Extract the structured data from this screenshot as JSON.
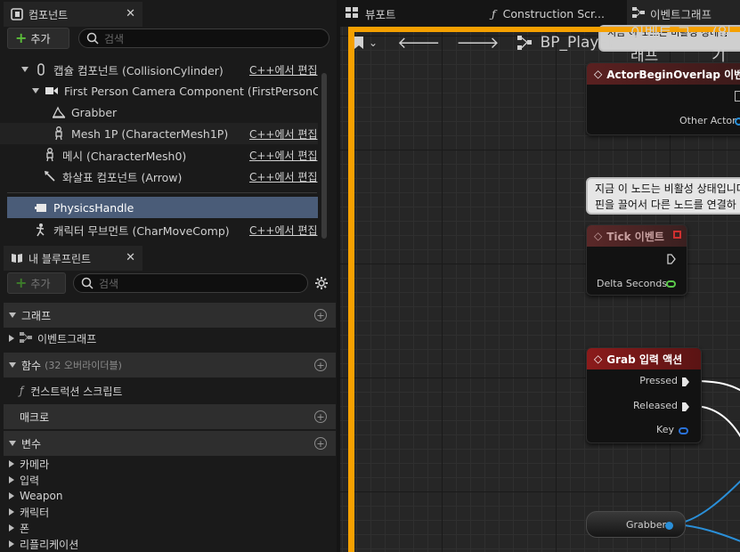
{
  "components_panel": {
    "tab_title": "컴포넌트",
    "add_label": "추가",
    "search_placeholder": "검색",
    "items": [
      {
        "label": "캡슐 컴포넌트 (CollisionCylinder)",
        "edit": "C++에서 편집"
      },
      {
        "label": "First Person Camera Component (FirstPersonCamera)",
        "edit": ""
      },
      {
        "label": "Grabber",
        "edit": ""
      },
      {
        "label": "Mesh 1P (CharacterMesh1P)",
        "edit": "C++에서 편집"
      },
      {
        "label": "메시 (CharacterMesh0)",
        "edit": "C++에서 편집"
      },
      {
        "label": "화살표 컴포넌트 (Arrow)",
        "edit": "C++에서 편집"
      },
      {
        "label": "PhysicsHandle",
        "edit": ""
      },
      {
        "label": "캐릭터 무브먼트 (CharMoveComp)",
        "edit": "C++에서 편집"
      }
    ]
  },
  "blueprint_panel": {
    "tab_title": "내 블루프린트",
    "add_label": "추가",
    "search_placeholder": "검색",
    "sections": {
      "graph": "그래프",
      "event_graph": "이벤트그래프",
      "functions": "함수",
      "functions_sub": "(32 오버라이더블)",
      "construction_script": "컨스트럭션 스크립트",
      "macros": "매크로",
      "variables": "변수"
    },
    "variable_groups": [
      "카메라",
      "입력",
      "Weapon",
      "캐릭터",
      "폰",
      "리플리케이션"
    ]
  },
  "graph_tabs": [
    {
      "label": "뷰포트"
    },
    {
      "label": "Construction Scr..."
    },
    {
      "label": "이벤트그래프"
    }
  ],
  "breadcrumb": {
    "blueprint": "BP_Player",
    "graph": "이벤트 그래프",
    "suffix": "(읽기"
  },
  "nodes": {
    "overlap": {
      "title": "ActorBeginOverlap 이벤트",
      "pin": "Other Actor"
    },
    "comment": {
      "line1": "지금 이 노드는 비활성 상태입니다",
      "line2": "핀을 끌어서 다른 노드를 연결하"
    },
    "comment_top": "지금 이 노드는 비활성 상태입",
    "tick": {
      "title": "Tick 이벤트",
      "pin": "Delta Seconds"
    },
    "grab": {
      "title": "Grab 입력 액션",
      "pressed": "Pressed",
      "released": "Released",
      "key": "Key"
    },
    "grabber_var": {
      "label": "Grabber"
    }
  },
  "colors": {
    "accent_orange": "#f5a000",
    "event_red": "#8b1b1b",
    "selected_row": "#4a5c78",
    "add_green": "#5bbd3a"
  }
}
